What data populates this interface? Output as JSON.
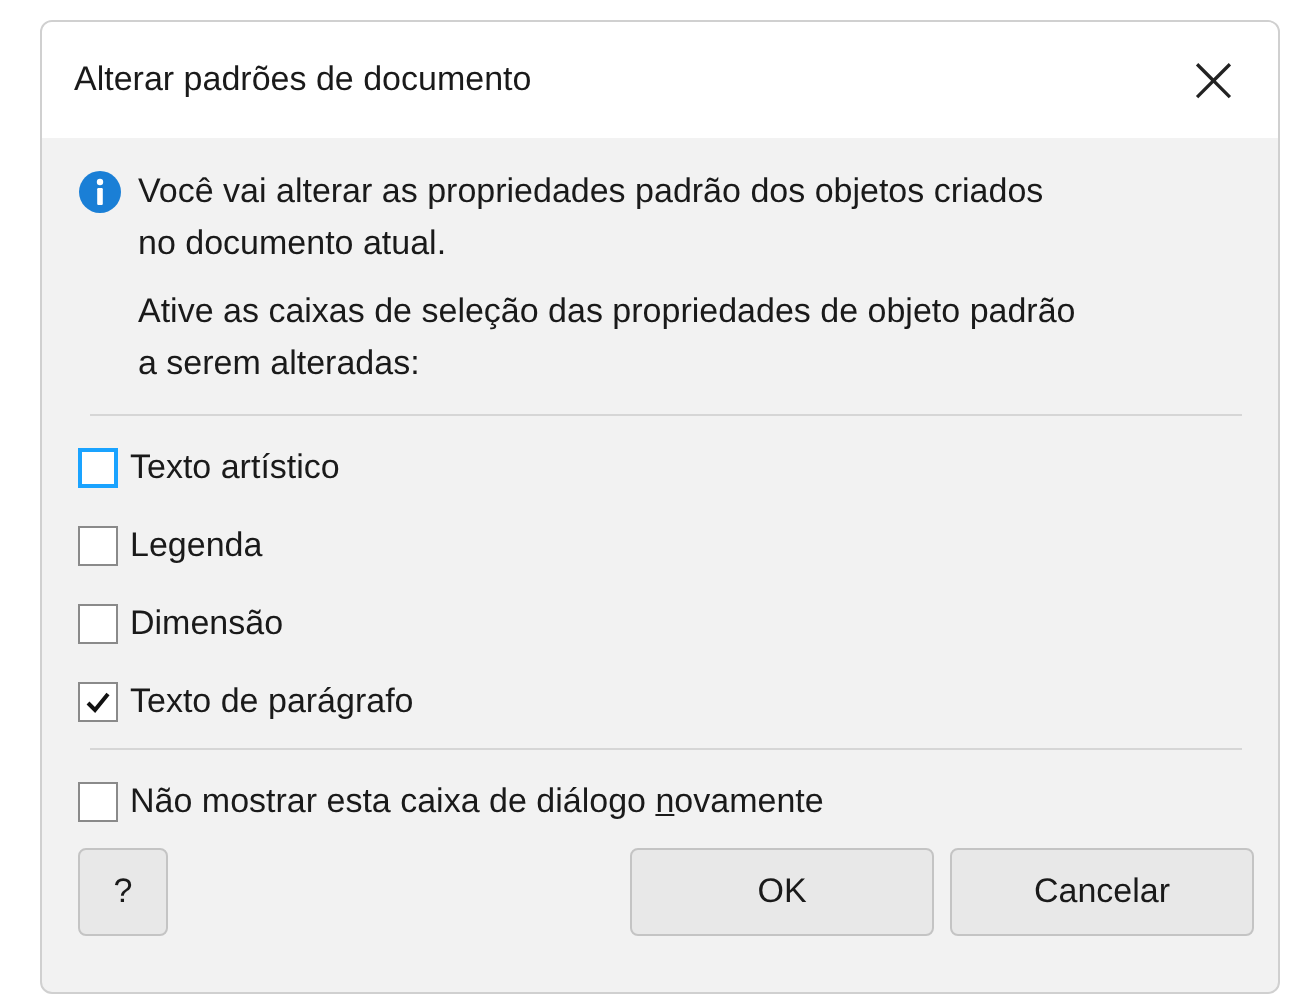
{
  "window": {
    "title": "Alterar padrões de documento",
    "close": "×"
  },
  "info": {
    "message": "Você vai alterar as propriedades padrão dos objetos criados no documento atual.",
    "instruction": "Ative as caixas de seleção das propriedades de objeto padrão a serem alteradas:"
  },
  "properties": [
    {
      "label": "Texto artístico",
      "checked": false,
      "focused": true
    },
    {
      "label": "Legenda",
      "checked": false,
      "focused": false
    },
    {
      "label": "Dimensão",
      "checked": false,
      "focused": false
    },
    {
      "label": "Texto de parágrafo",
      "checked": true,
      "focused": false
    }
  ],
  "dont_show_again": {
    "checked": false,
    "label_parts": [
      {
        "text": "Não mostrar esta caixa de diálogo ",
        "underlined": false
      },
      {
        "text": "n",
        "underlined": true
      },
      {
        "text": "ovamente",
        "underlined": false
      }
    ]
  },
  "buttons": {
    "help": "?",
    "ok": "OK",
    "cancel": "Cancelar"
  }
}
